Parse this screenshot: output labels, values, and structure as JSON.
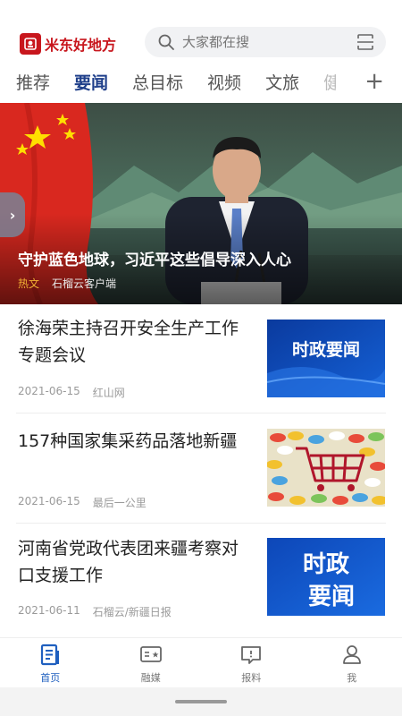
{
  "header": {
    "app_name": "米东好地方",
    "search_placeholder": "大家都在搜"
  },
  "tabs": [
    {
      "label": "推荐",
      "active": false
    },
    {
      "label": "要闻",
      "active": true
    },
    {
      "label": "总目标",
      "active": false
    },
    {
      "label": "视频",
      "active": false
    },
    {
      "label": "文旅",
      "active": false
    },
    {
      "label": "健",
      "active": false
    }
  ],
  "hero": {
    "title": "守护蓝色地球，习近平这些倡导深入人心",
    "tag": "热文",
    "source": "石榴云客户端",
    "handle": "›"
  },
  "news": [
    {
      "title": "徐海荣主持召开安全生产工作专题会议",
      "date": "2021-06-15",
      "source": "红山网",
      "thumb": "时政要闻"
    },
    {
      "title": "157种国家集采药品落地新疆",
      "date": "2021-06-15",
      "source": "最后一公里",
      "thumb": "pills-cart"
    },
    {
      "title": "河南省党政代表团来疆考察对口支援工作",
      "date": "2021-06-11",
      "source": "石榴云/新疆日报",
      "thumb": "时政要闻"
    }
  ],
  "nav": [
    {
      "label": "首页",
      "icon": "home-icon",
      "active": true
    },
    {
      "label": "融媒",
      "icon": "media-icon",
      "active": false
    },
    {
      "label": "报料",
      "icon": "report-icon",
      "active": false
    },
    {
      "label": "我",
      "icon": "profile-icon",
      "active": false
    }
  ],
  "thumb_text": {
    "item1": "时政要闻",
    "item3_line1": "时政",
    "item3_line2": "要闻"
  },
  "colors": {
    "brand_red": "#c8161d",
    "accent_blue": "#1f3f8a",
    "tag_orange": "#f2b134"
  }
}
